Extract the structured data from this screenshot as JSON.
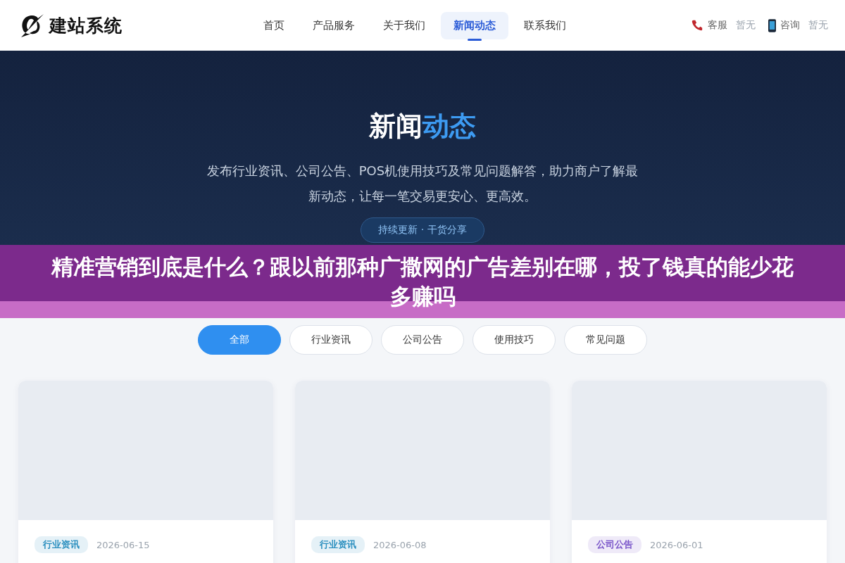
{
  "header": {
    "logo_text": "建站系统",
    "nav": [
      {
        "label": "首页",
        "selected": false
      },
      {
        "label": "产品服务",
        "selected": false
      },
      {
        "label": "关于我们",
        "selected": false
      },
      {
        "label": "新闻动态",
        "selected": true
      },
      {
        "label": "联系我们",
        "selected": false
      }
    ],
    "contacts": [
      {
        "kind": "phone",
        "label": "客服",
        "value": "暂无"
      },
      {
        "kind": "mobile",
        "label": "咨询",
        "value": "暂无"
      }
    ]
  },
  "hero": {
    "title": "新闻",
    "title_highlight": "动态",
    "description": "发布行业资讯、公司公告、POS机使用技巧及常见问题解答，助力商户了解最新动态，让每一笔交易更安心、更高效。",
    "badge": "持续更新 · 干货分享"
  },
  "banner": {
    "text": "精准营销到底是什么？跟以前那种广撒网的广告差别在哪，投了钱真的能少花多赚吗"
  },
  "filters": [
    {
      "label": "全部",
      "selected": true
    },
    {
      "label": "行业资讯",
      "selected": false
    },
    {
      "label": "公司公告",
      "selected": false
    },
    {
      "label": "使用技巧",
      "selected": false
    },
    {
      "label": "常见问题",
      "selected": false
    }
  ],
  "cards": [
    {
      "tag": "行业资讯",
      "color": "#2b8fbf",
      "date": "2026-06-15"
    },
    {
      "tag": "行业资讯",
      "color": "#2b8fbf",
      "date": "2026-06-08"
    },
    {
      "tag": "公司公告",
      "color": "#7a55c9",
      "date": "2026-06-01"
    }
  ]
}
